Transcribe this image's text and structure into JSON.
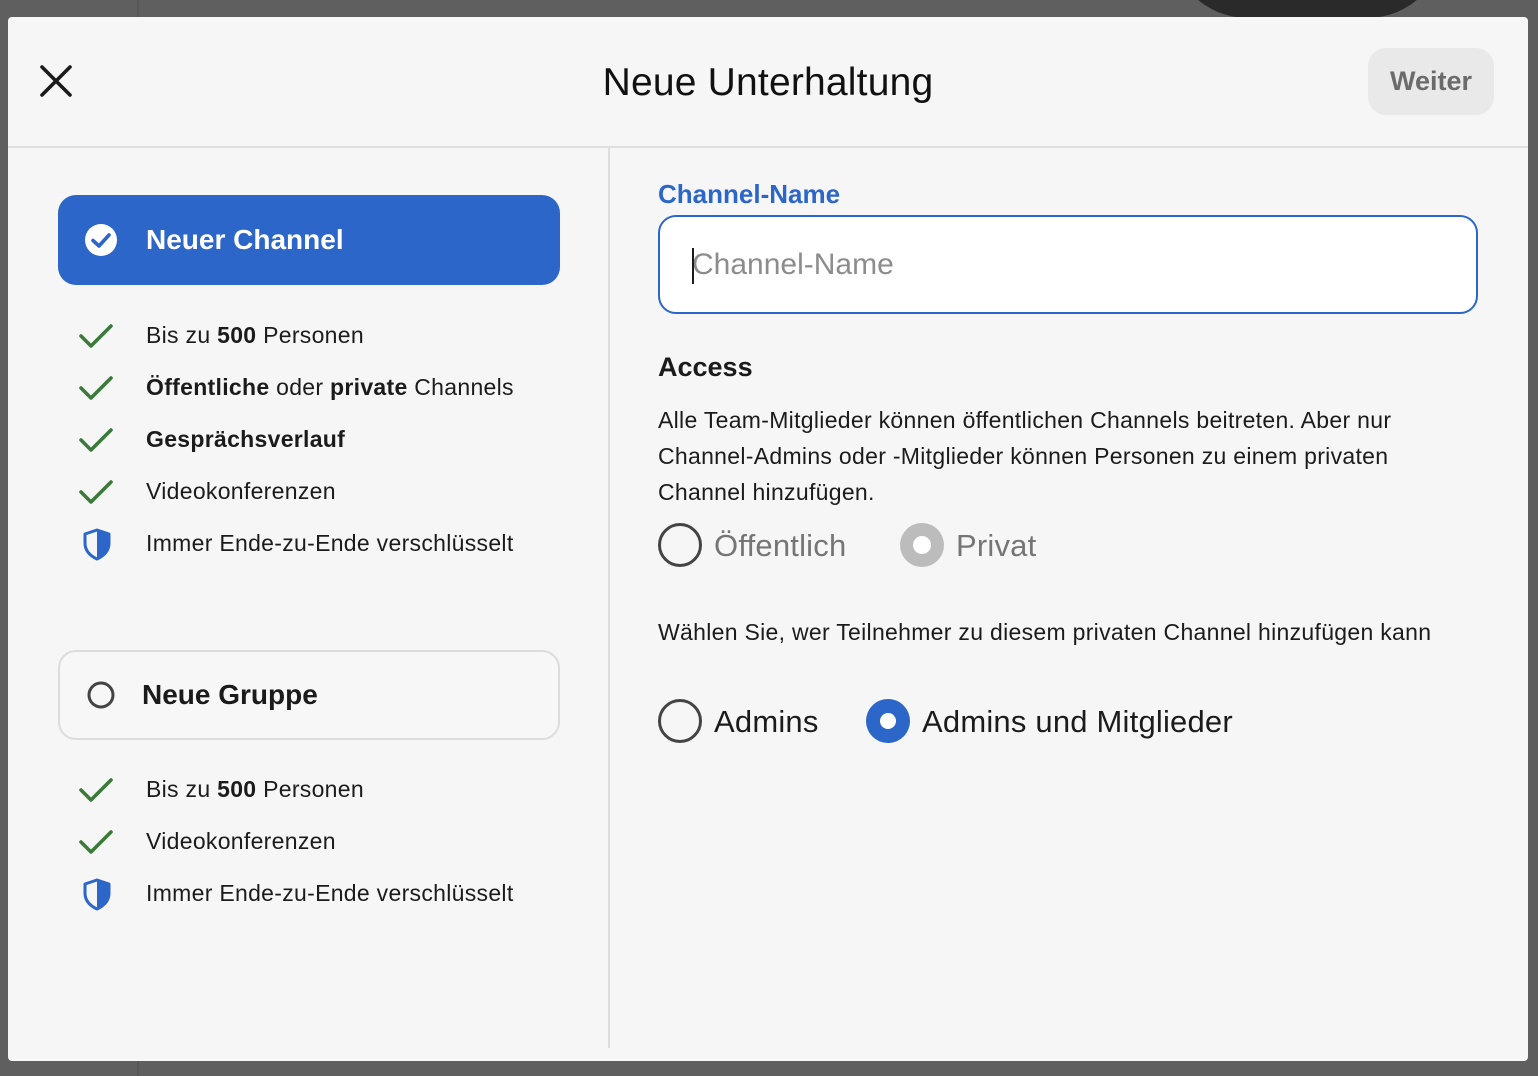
{
  "dialog": {
    "title": "Neue Unterhaltung",
    "next_label": "Weiter",
    "accent_color": "#2c66c8"
  },
  "options": {
    "channel": {
      "label": "Neuer Channel",
      "selected": true,
      "features": [
        {
          "icon": "check-icon",
          "parts": [
            "Bis zu ",
            "500",
            " Personen"
          ]
        },
        {
          "icon": "check-icon",
          "parts": [
            "Öffentliche",
            " oder ",
            "private",
            " Channels"
          ]
        },
        {
          "icon": "check-icon",
          "parts": [
            "Gesprächsverlauf"
          ]
        },
        {
          "icon": "check-icon",
          "parts": [
            "Videokonferenzen"
          ]
        },
        {
          "icon": "shield-icon",
          "parts": [
            "Immer Ende-zu-Ende verschlüsselt"
          ]
        }
      ]
    },
    "group": {
      "label": "Neue Gruppe",
      "selected": false,
      "features": [
        {
          "icon": "check-icon",
          "parts": [
            "Bis zu ",
            "500",
            " Personen"
          ]
        },
        {
          "icon": "check-icon",
          "parts": [
            "Videokonferenzen"
          ]
        },
        {
          "icon": "shield-icon",
          "parts": [
            "Immer Ende-zu-Ende verschlüsselt"
          ]
        }
      ]
    }
  },
  "form": {
    "name_label": "Channel-Name",
    "name_placeholder": "Channel-Name",
    "name_value": "",
    "access_title": "Access",
    "access_description": "Alle Team-Mitglieder können öffentlichen Channels beitreten. Aber nur Channel-Admins oder -Mitglieder können Personen zu einem privaten Channel hinzufügen.",
    "access_options": [
      {
        "label": "Öffentlich",
        "checked": false
      },
      {
        "label": "Privat",
        "checked": true,
        "disabled": true
      }
    ],
    "permission_description": "Wählen Sie, wer Teilnehmer zu diesem privaten Channel hinzufügen kann",
    "permission_options": [
      {
        "label": "Admins",
        "checked": false
      },
      {
        "label": "Admins und Mitglieder",
        "checked": true
      }
    ]
  }
}
